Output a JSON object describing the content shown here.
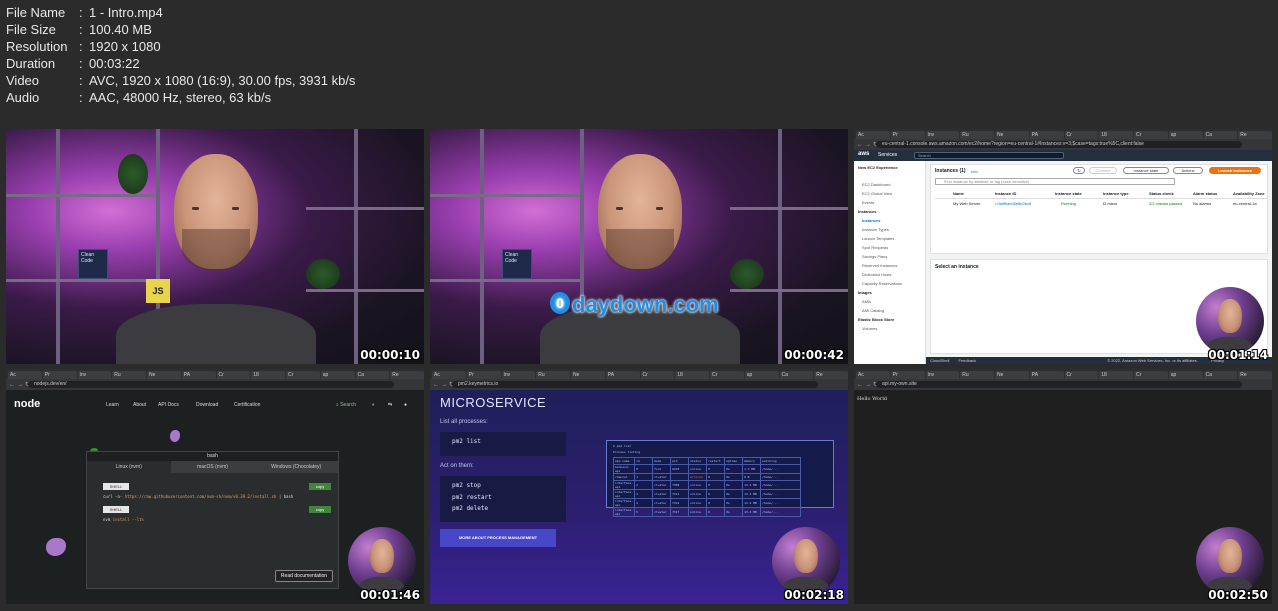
{
  "file_info": [
    {
      "key": "File Name",
      "value": "1 - Intro.mp4"
    },
    {
      "key": "File Size",
      "value": "100.40 MB"
    },
    {
      "key": "Resolution",
      "value": "1920 x 1080"
    },
    {
      "key": "Duration",
      "value": "00:03:22"
    },
    {
      "key": "Video",
      "value": "AVC, 1920 x 1080 (16:9), 30.00 fps, 3931 kb/s"
    },
    {
      "key": "Audio",
      "value": "AAC, 48000 Hz, stereo, 63 kb/s"
    }
  ],
  "separator": ":",
  "thumbnails": [
    {
      "timestamp": "00:00:10"
    },
    {
      "timestamp": "00:00:42",
      "watermark": "daydown.com"
    },
    {
      "timestamp": "00:01:14"
    },
    {
      "timestamp": "00:01:46"
    },
    {
      "timestamp": "00:02:18"
    },
    {
      "timestamp": "00:02:50"
    }
  ],
  "studio": {
    "book_label": "Clean Code",
    "js_label": "JS"
  },
  "aws": {
    "url": "eu-central-1.console.aws.amazon.com/ec2/home?region=eu-central-1#Instances:v=3;$case=tags:true%5C,client:false",
    "logo": "aws",
    "services": "Services",
    "search_placeholder": "Search",
    "nav_title": "New EC2 Experience",
    "nav_items": [
      "EC2 Dashboard",
      "EC2 Global View",
      "Events",
      "Instances",
      "Instances",
      "Instance Types",
      "Launch Templates",
      "Spot Requests",
      "Savings Plans",
      "Reserved Instances",
      "Dedicated Hosts",
      "Capacity Reservations",
      "Images",
      "AMIs",
      "AMI Catalog",
      "Elastic Block Store",
      "Volumes"
    ],
    "instances_title": "Instances (1)",
    "info_link": "Info",
    "connect": "Connect",
    "instance_state": "Instance state",
    "actions": "Actions",
    "launch": "Launch instances",
    "filter_placeholder": "Find instance by attribute or tag (case-sensitive)",
    "columns": [
      "Name",
      "Instance ID",
      "Instance state",
      "Instance type",
      "Status check",
      "Alarm status",
      "Availability Zone"
    ],
    "row": [
      "My Web Server",
      "i-0faff0ac95e8b0bc8",
      "Running",
      "t2.micro",
      "2/2 checks passed",
      "No alarms",
      "eu-central-1a"
    ],
    "select_instance": "Select an instance",
    "footer_left": "CloudShell",
    "footer_feedback": "Feedback",
    "footer_right": "© 2022, Amazon Web Services, Inc. or its affiliates.",
    "footer_privacy": "Privacy"
  },
  "node": {
    "url": "nodejs.dev/en/",
    "logo": "node",
    "nav": [
      "Learn",
      "About",
      "API Docs",
      "Download",
      "Certification"
    ],
    "search": "Search",
    "terminal_title": "bash",
    "tabs": [
      "Linux (nvm)",
      "macOS (nvm)",
      "Windows (Chocolatey)"
    ],
    "shell": "SHELL",
    "copy": "copy",
    "cmd1_prefix": "curl -o-",
    "cmd1_url": "https://raw.githubusercontent.com/nvm-sh/nvm/v0.39.2/install.sh",
    "cmd1_suffix": "| bash",
    "cmd2_prefix": "nvm",
    "cmd2_args": "install --lts",
    "read_docs": "Read documentation"
  },
  "pm2": {
    "url": "pm2.keymetrics.io",
    "heading": "MICROSERVICE",
    "list_label": "List all processes:",
    "list_cmd": "pm2 list",
    "act_label": "Act on them:",
    "act_cmds": [
      "pm2 stop",
      "pm2 restart",
      "pm2 delete"
    ],
    "more_button": "MORE ABOUT PROCESS MANAGEMENT",
    "table_prompt": "$ pm2 list",
    "table_subtitle": "Process listing",
    "table_headers": [
      "App name",
      "id",
      "mode",
      "pid",
      "status",
      "restart",
      "uptime",
      "memory",
      "watching"
    ],
    "table_rows": [
      [
        "backend-api",
        "0",
        "fork",
        "6470",
        "online",
        "0",
        "0s",
        "1.3 MB",
        "/home/..."
      ],
      [
        "channel",
        "1",
        "cluster",
        "",
        "errored",
        "0",
        "0s",
        "0 B",
        "/home/..."
      ],
      [
        "interface-api",
        "2",
        "cluster",
        "7309",
        "online",
        "0",
        "0s",
        "13.4 MB",
        "/home/..."
      ],
      [
        "interface-api",
        "3",
        "cluster",
        "7311",
        "online",
        "0",
        "0s",
        "13.4 MB",
        "/home/..."
      ],
      [
        "interface-api",
        "4",
        "cluster",
        "7312",
        "online",
        "0",
        "0s",
        "13.4 MB",
        "/home/..."
      ],
      [
        "interface-api",
        "5",
        "cluster",
        "7317",
        "online",
        "0",
        "0s",
        "13.4 MB",
        "/home/..."
      ]
    ]
  },
  "api": {
    "url": "api.my-own.site",
    "body": "Hello World"
  },
  "tabs": [
    "Ac",
    "Pr",
    "Inv",
    "Ru",
    "Ne",
    "PA",
    "Cr",
    "18",
    "Cr",
    "ap",
    "Ca",
    "Re"
  ]
}
